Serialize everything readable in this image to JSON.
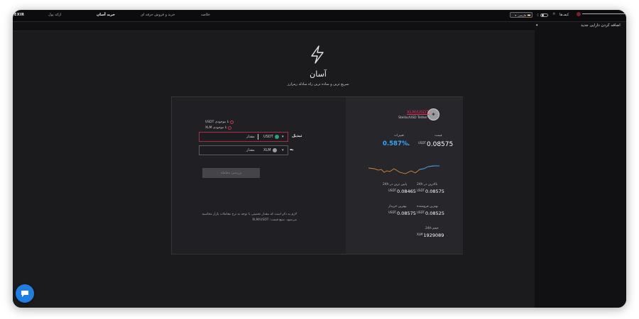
{
  "topbar": {
    "logo": "EXIR",
    "nav": [
      "ارائه پول",
      "خرید آسان",
      "خرید و فروش حرفه ای",
      "خلاصه"
    ],
    "language": "فارسی",
    "wallets": "کیف‌ها"
  },
  "sidebar": {
    "add_asset": "اضافه کردن دارایی جدید"
  },
  "hero": {
    "title": "آسان",
    "subtitle": "سریع ترین و ساده ترین راه مبادله رمزارز"
  },
  "market": {
    "pair": "XLM/USDT",
    "pair_sub": "Stellar/USD Tether",
    "price_label": "قیمت",
    "change_label": "تغییرات",
    "price_unit": "USDT",
    "price": "0.08575",
    "change": "0.587%",
    "high24_label": "بالاترین در 24h",
    "low24_label": "پایین ترین در 24h",
    "high24": "0.08575",
    "low24": "0.08465",
    "best_bid_label": "بهترین خریدار",
    "best_ask_label": "بهترین فروشنده",
    "best_bid": "0.08575",
    "best_ask": "0.08525",
    "volume_label": "حجم 24h",
    "volume_unit": "XLM",
    "volume": "1929089"
  },
  "form": {
    "option_usdt": "تا موجودی USDT",
    "option_xlm": "تا موجودی XLM",
    "convert_label": "تبدیل",
    "to_label": "به",
    "from_coin": "USDT",
    "to_coin": "XLM",
    "amount_placeholder": "مقدار",
    "confirm": "بررسی معامله",
    "note": "لازم به ذکر است که مقدار تخمینی با توجه به نرخ معاملات بازار محاسبه می‌شود. منبع قیمت: XLM/USDT"
  },
  "colors": {
    "accent": "#e03050",
    "positive": "#35a7ff",
    "chat": "#1f7ee0"
  }
}
